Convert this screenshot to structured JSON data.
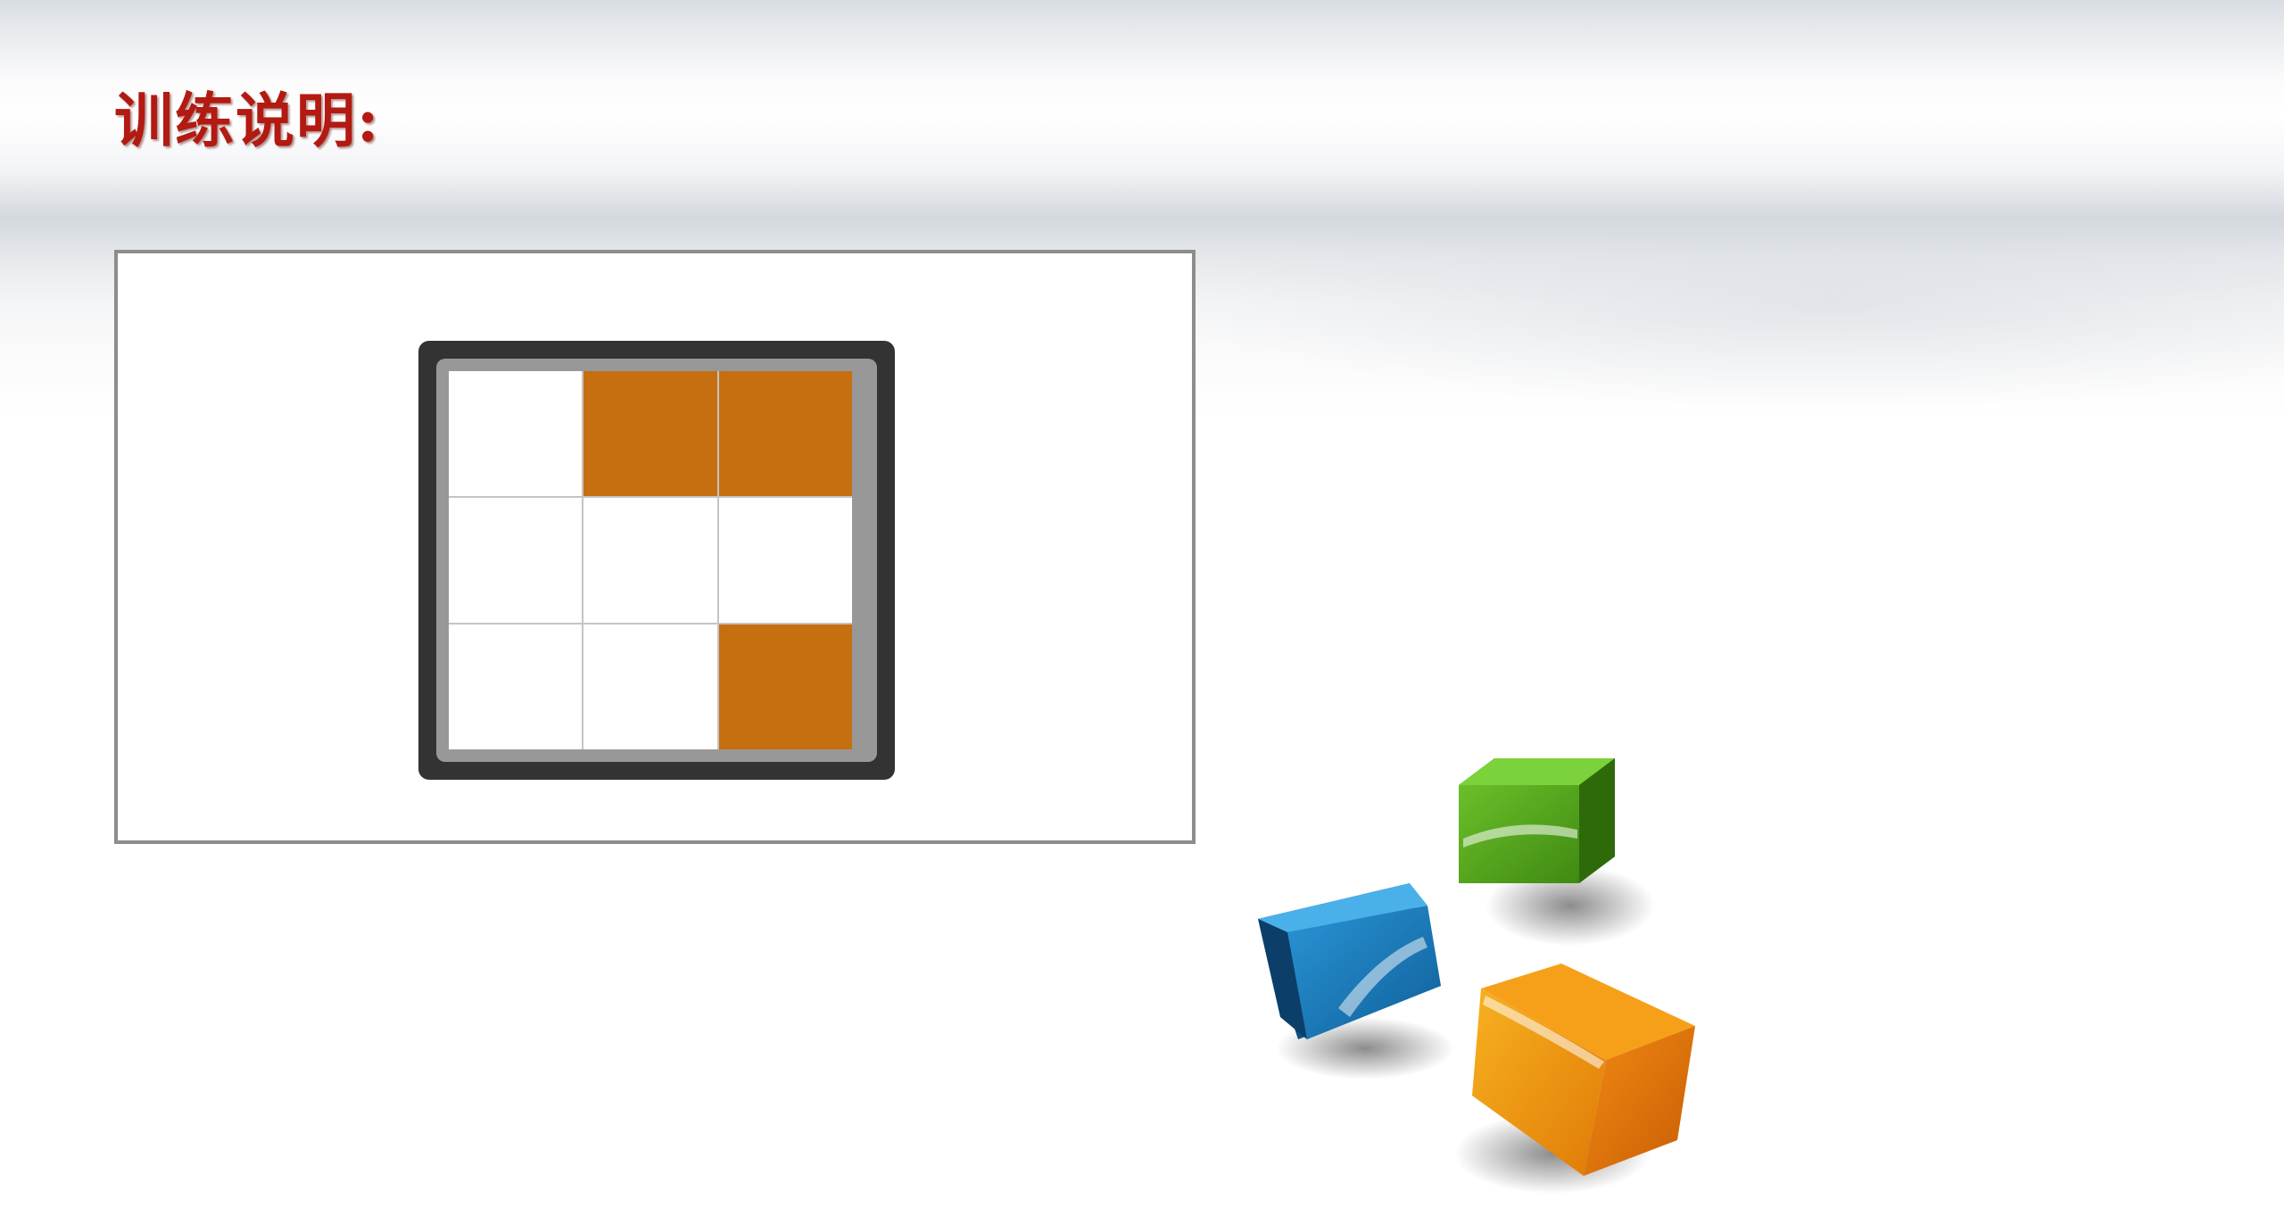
{
  "slide": {
    "title": "训练说明:"
  },
  "grid": {
    "rows": 3,
    "cols": 3,
    "cells": [
      [
        false,
        true,
        true
      ],
      [
        false,
        false,
        false
      ],
      [
        false,
        false,
        true
      ]
    ],
    "colors": {
      "filled": "#c56f11",
      "empty": "#ffffff",
      "frame_outer": "#333333",
      "frame_inner": "#989898"
    }
  },
  "decor": {
    "cubes": [
      {
        "name": "green-cube-icon",
        "color": "#5aa71e"
      },
      {
        "name": "blue-cube-icon",
        "color": "#1f7fc0"
      },
      {
        "name": "orange-cube-icon",
        "color": "#f09a12"
      }
    ]
  }
}
